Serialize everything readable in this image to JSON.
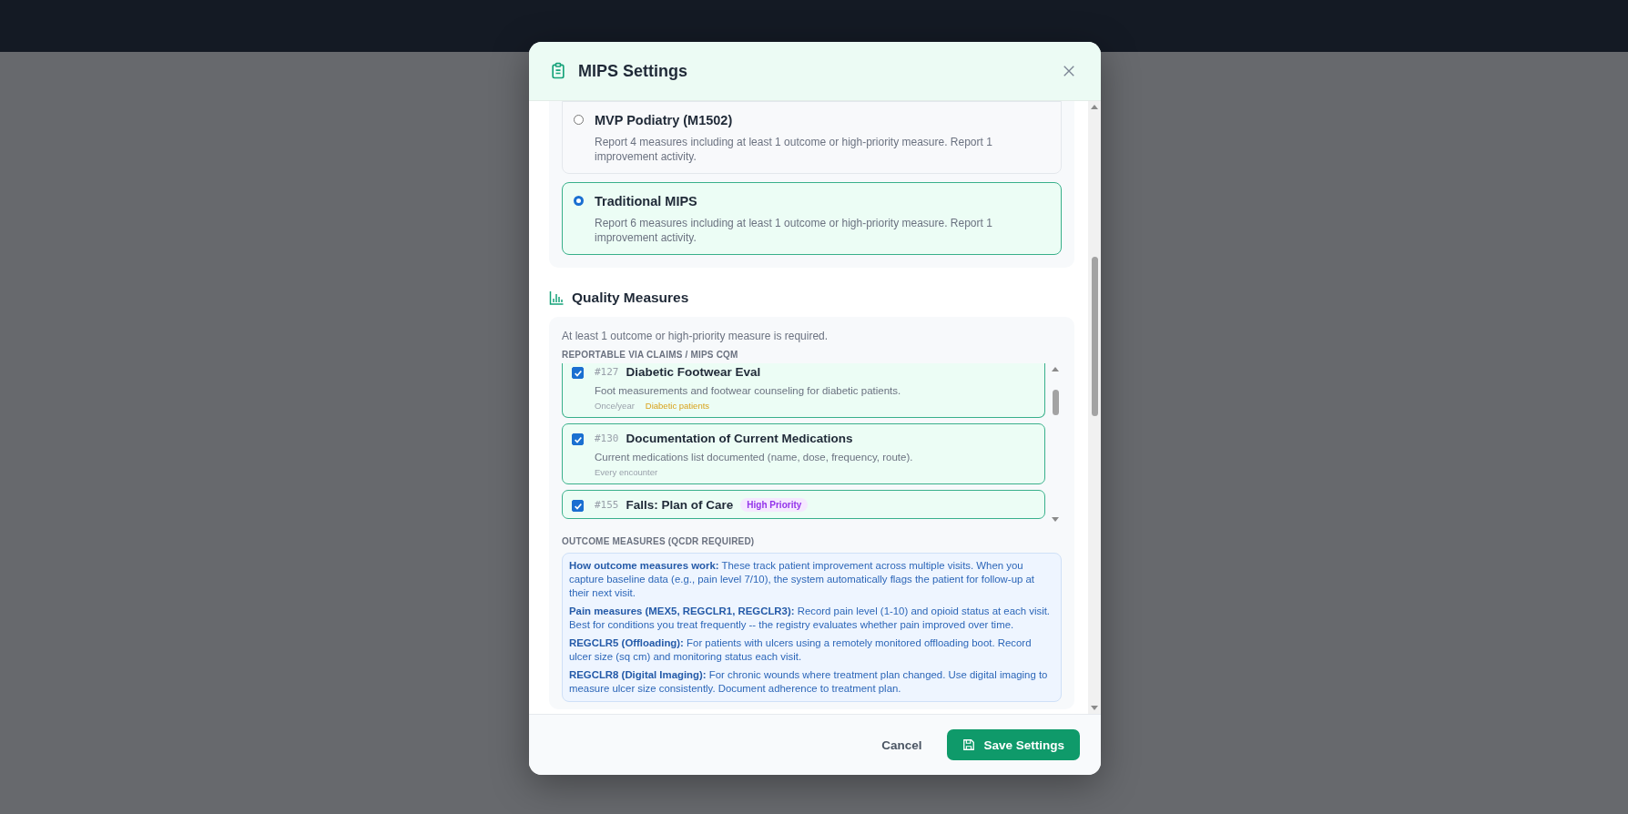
{
  "dialog": {
    "title": "MIPS Settings",
    "plans": [
      {
        "name": "MVP Podiatry (M1502)",
        "description": "Report 4 measures including at least 1 outcome or high-priority measure. Report 1 improvement activity.",
        "selected": false
      },
      {
        "name": "Traditional MIPS",
        "description": "Report 6 measures including at least 1 outcome or high-priority measure. Report 1 improvement activity.",
        "selected": true
      }
    ],
    "quality_measures": {
      "title": "Quality Measures",
      "note": "At least 1 outcome or high-priority measure is required.",
      "claims_label": "REPORTABLE VIA CLAIMS / MIPS CQM",
      "measures": [
        {
          "number": "#127",
          "name": "Diabetic Footwear Eval",
          "description": "Foot measurements and footwear counseling for diabetic patients.",
          "frequency": "Once/year",
          "population": "Diabetic patients",
          "checked": true
        },
        {
          "number": "#130",
          "name": "Documentation of Current Medications",
          "description": "Current medications list documented (name, dose, frequency, route).",
          "frequency": "Every encounter",
          "checked": true
        },
        {
          "number": "#155",
          "name": "Falls: Plan of Care",
          "badge": "High Priority",
          "checked": true
        }
      ],
      "outcome_label": "OUTCOME MEASURES (QCDR REQUIRED)",
      "outcome_info": [
        "**How outcome measures work:** These track patient improvement across multiple visits. When you capture baseline data (e.g., pain level 7/10), the system automatically flags the patient for follow-up at their next visit.",
        "**Pain measures (MEX5, REGCLR1, REGCLR3):** Record pain level (1-10) and opioid status at each visit. Best for conditions you treat frequently -- the registry evaluates whether pain improved over time.",
        "**REGCLR5 (Offloading):** For patients with ulcers using a remotely monitored offloading boot. Record ulcer size (sq cm) and monitoring status each visit.",
        "**REGCLR8 (Digital Imaging):** For chronic wounds where treatment plan changed. Use digital imaging to measure ulcer size consistently. Document adherence to treatment plan."
      ]
    },
    "buttons": {
      "cancel": "Cancel",
      "save": "Save Settings"
    }
  }
}
